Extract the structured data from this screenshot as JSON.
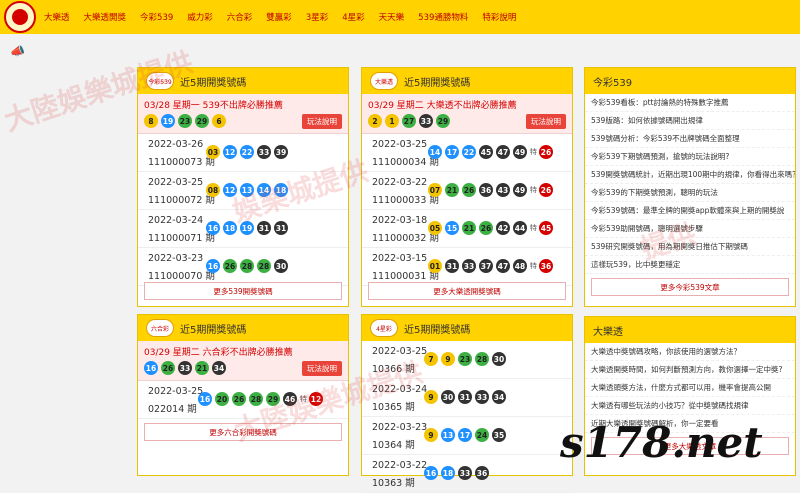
{
  "nav": {
    "items": [
      "大樂透",
      "大樂透開獎",
      "今彩539",
      "威力彩",
      "六合彩",
      "雙贏彩",
      "3星彩",
      "4星彩",
      "天天樂",
      "539通勝物料",
      "特彩說明"
    ]
  },
  "colors": {
    "yellow": "#ffd200",
    "red": "#d40000",
    "blue": "#1e90ff",
    "green": "#3cb043",
    "black": "#333333",
    "gold": "#f5c400"
  },
  "panel539": {
    "badge": "今彩539",
    "title": "近5期開獎號碼",
    "notice": "03/28 星期一 539不出牌必勝推薦",
    "notice_balls": [
      {
        "n": "8",
        "c": "gold"
      },
      {
        "n": "19",
        "c": "blue"
      },
      {
        "n": "23",
        "c": "green"
      },
      {
        "n": "29",
        "c": "green"
      },
      {
        "n": "6",
        "c": "gold"
      }
    ],
    "tips": "玩法說明",
    "rows": [
      {
        "date": "2022-03-26",
        "period": "111000073 期",
        "balls": [
          {
            "n": "03",
            "c": "gold"
          },
          {
            "n": "12",
            "c": "blue"
          },
          {
            "n": "22",
            "c": "blue"
          },
          {
            "n": "33",
            "c": "black"
          },
          {
            "n": "39",
            "c": "black"
          }
        ]
      },
      {
        "date": "2022-03-25",
        "period": "111000072 期",
        "balls": [
          {
            "n": "08",
            "c": "gold"
          },
          {
            "n": "12",
            "c": "blue"
          },
          {
            "n": "13",
            "c": "blue"
          },
          {
            "n": "14",
            "c": "blue"
          },
          {
            "n": "18",
            "c": "blue"
          }
        ]
      },
      {
        "date": "2022-03-24",
        "period": "111000071 期",
        "balls": [
          {
            "n": "16",
            "c": "blue"
          },
          {
            "n": "18",
            "c": "blue"
          },
          {
            "n": "19",
            "c": "blue"
          },
          {
            "n": "31",
            "c": "black"
          },
          {
            "n": "31",
            "c": "black"
          }
        ]
      },
      {
        "date": "2022-03-23",
        "period": "111000070 期",
        "balls": [
          {
            "n": "16",
            "c": "blue"
          },
          {
            "n": "26",
            "c": "green"
          },
          {
            "n": "28",
            "c": "green"
          },
          {
            "n": "28",
            "c": "green"
          },
          {
            "n": "30",
            "c": "black"
          }
        ]
      }
    ],
    "more": "更多539開獎號碼"
  },
  "panelBig": {
    "badge": "大樂透",
    "title": "近5期開獎號碼",
    "notice": "03/29 星期二 大樂透不出牌必勝推薦",
    "notice_balls": [
      {
        "n": "2",
        "c": "gold"
      },
      {
        "n": "1",
        "c": "gold"
      },
      {
        "n": "27",
        "c": "green"
      },
      {
        "n": "33",
        "c": "black"
      },
      {
        "n": "29",
        "c": "green"
      }
    ],
    "tips": "玩法說明",
    "rows": [
      {
        "date": "2022-03-25",
        "period": "111000034 期",
        "balls": [
          {
            "n": "14",
            "c": "blue"
          },
          {
            "n": "17",
            "c": "blue"
          },
          {
            "n": "22",
            "c": "blue"
          },
          {
            "n": "45",
            "c": "black"
          },
          {
            "n": "47",
            "c": "black"
          },
          {
            "n": "49",
            "c": "black"
          }
        ],
        "special": {
          "n": "26",
          "c": "red"
        }
      },
      {
        "date": "2022-03-22",
        "period": "111000033 期",
        "balls": [
          {
            "n": "07",
            "c": "gold"
          },
          {
            "n": "21",
            "c": "green"
          },
          {
            "n": "26",
            "c": "green"
          },
          {
            "n": "36",
            "c": "black"
          },
          {
            "n": "43",
            "c": "black"
          },
          {
            "n": "49",
            "c": "black"
          }
        ],
        "special": {
          "n": "26",
          "c": "red"
        }
      },
      {
        "date": "2022-03-18",
        "period": "111000032 期",
        "balls": [
          {
            "n": "05",
            "c": "gold"
          },
          {
            "n": "15",
            "c": "blue"
          },
          {
            "n": "21",
            "c": "green"
          },
          {
            "n": "26",
            "c": "green"
          },
          {
            "n": "42",
            "c": "black"
          },
          {
            "n": "44",
            "c": "black"
          }
        ],
        "special": {
          "n": "45",
          "c": "red"
        }
      },
      {
        "date": "2022-03-15",
        "period": "111000031 期",
        "balls": [
          {
            "n": "01",
            "c": "gold"
          },
          {
            "n": "31",
            "c": "black"
          },
          {
            "n": "33",
            "c": "black"
          },
          {
            "n": "37",
            "c": "black"
          },
          {
            "n": "47",
            "c": "black"
          },
          {
            "n": "48",
            "c": "black"
          }
        ],
        "special": {
          "n": "36",
          "c": "red"
        }
      }
    ],
    "more": "更多大樂透開獎號碼"
  },
  "panelMark6": {
    "badge": "六合彩",
    "title": "近5期開獎號碼",
    "notice": "03/29 星期二 六合彩不出牌必勝推薦",
    "notice_balls": [
      {
        "n": "16",
        "c": "blue"
      },
      {
        "n": "26",
        "c": "green"
      },
      {
        "n": "33",
        "c": "black"
      },
      {
        "n": "21",
        "c": "green"
      },
      {
        "n": "34",
        "c": "black"
      }
    ],
    "tips": "玩法說明",
    "rows": [
      {
        "date": "2022-03-25",
        "period": "022014 期",
        "balls": [
          {
            "n": "16",
            "c": "blue"
          },
          {
            "n": "20",
            "c": "green"
          },
          {
            "n": "26",
            "c": "green"
          },
          {
            "n": "28",
            "c": "green"
          },
          {
            "n": "29",
            "c": "green"
          },
          {
            "n": "46",
            "c": "black"
          }
        ],
        "special": {
          "n": "12",
          "c": "red"
        }
      }
    ],
    "more": "更多六合彩開獎號碼"
  },
  "panel4": {
    "badge": "4星彩",
    "title": "近5期開獎號碼",
    "rows": [
      {
        "date": "2022-03-25",
        "period": "10366 期",
        "balls": [
          {
            "n": "7",
            "c": "gold"
          },
          {
            "n": "9",
            "c": "gold"
          },
          {
            "n": "23",
            "c": "green"
          },
          {
            "n": "28",
            "c": "green"
          },
          {
            "n": "30",
            "c": "black"
          }
        ]
      },
      {
        "date": "2022-03-24",
        "period": "10365 期",
        "balls": [
          {
            "n": "9",
            "c": "gold"
          },
          {
            "n": "30",
            "c": "black"
          },
          {
            "n": "31",
            "c": "black"
          },
          {
            "n": "33",
            "c": "black"
          },
          {
            "n": "34",
            "c": "black"
          }
        ]
      },
      {
        "date": "2022-03-23",
        "period": "10364 期",
        "balls": [
          {
            "n": "9",
            "c": "gold"
          },
          {
            "n": "13",
            "c": "blue"
          },
          {
            "n": "17",
            "c": "blue"
          },
          {
            "n": "24",
            "c": "green"
          },
          {
            "n": "35",
            "c": "black"
          }
        ]
      },
      {
        "date": "2022-03-22",
        "period": "10363 期",
        "balls": [
          {
            "n": "16",
            "c": "blue"
          },
          {
            "n": "18",
            "c": "blue"
          },
          {
            "n": "33",
            "c": "black"
          },
          {
            "n": "36",
            "c": "black"
          }
        ]
      }
    ]
  },
  "side539": {
    "title": "今彩539",
    "items": [
      "今彩539看板：ptt討論熱的特殊數字推薦",
      "539版路：如何依據號碼開出規律",
      "539號碼分析：今彩539不出牌號碼全面整理",
      "今彩539下期號碼預測，搶號的玩法說明?",
      "539開獎號碼統計，近期出現100期中的規律，你看得出來嗎？",
      "今彩539的下期獎號預測，聰明的玩法",
      "今彩539號碼：最準全牌的開獎app軟體來與上期的開獎說",
      "今彩539助開號碼，聰明選號步驟",
      "539研究開獎號碼，用為期開獎日推估下期號碼",
      "這樣玩539，比中獎更穩定"
    ],
    "more": "更多今彩539文章"
  },
  "sideBig": {
    "title": "大樂透",
    "items": [
      "大樂透中獎號碼攻略，你該使用的選號方法？",
      "大樂透開獎時間，如何判斷預測方向，教你選擇一定中獎?",
      "大樂透頭獎方法，什麼方式都可以用，機率會提高公開",
      "大樂透有哪些玩法的小技巧？從中獎號碼找規律",
      "近期大樂透開獎號碼解析，你一定要看"
    ],
    "more": "更多大樂透文章"
  },
  "brand": "s178.net",
  "watermarks": [
    "大陸娛樂城提供",
    "娛樂城提供",
    "提供"
  ]
}
